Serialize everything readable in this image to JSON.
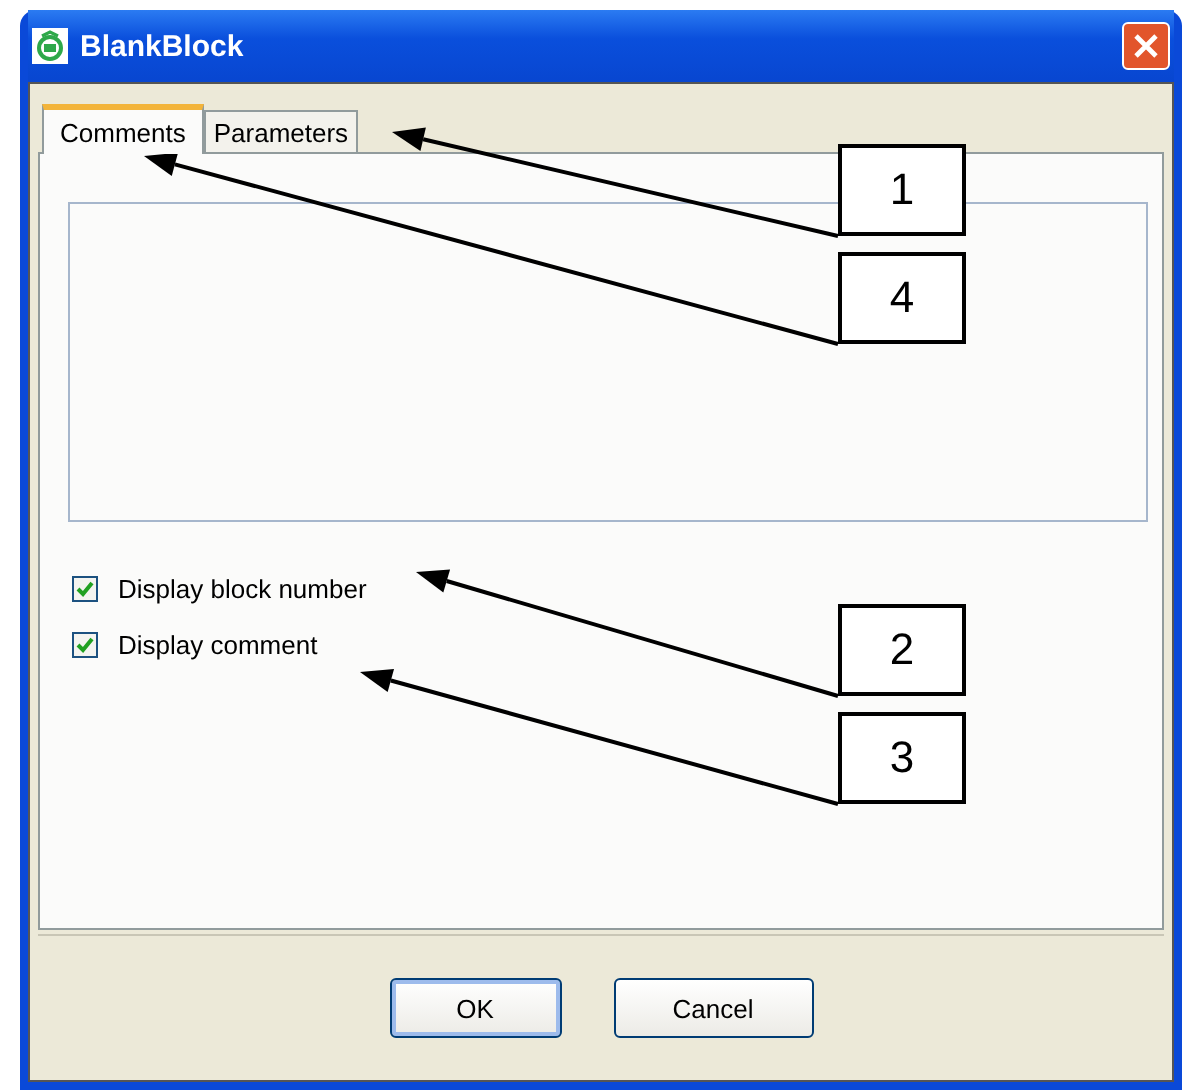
{
  "window": {
    "title": "BlankBlock"
  },
  "tabs": [
    {
      "label": "Comments",
      "selected": true
    },
    {
      "label": "Parameters",
      "selected": false
    }
  ],
  "options": [
    {
      "label": "Display block number",
      "checked": true
    },
    {
      "label": "Display comment",
      "checked": true
    }
  ],
  "buttons": [
    "OK",
    "Cancel"
  ],
  "callouts": [
    {
      "label": "1"
    },
    {
      "label": "4"
    },
    {
      "label": "2"
    },
    {
      "label": "3"
    }
  ]
}
